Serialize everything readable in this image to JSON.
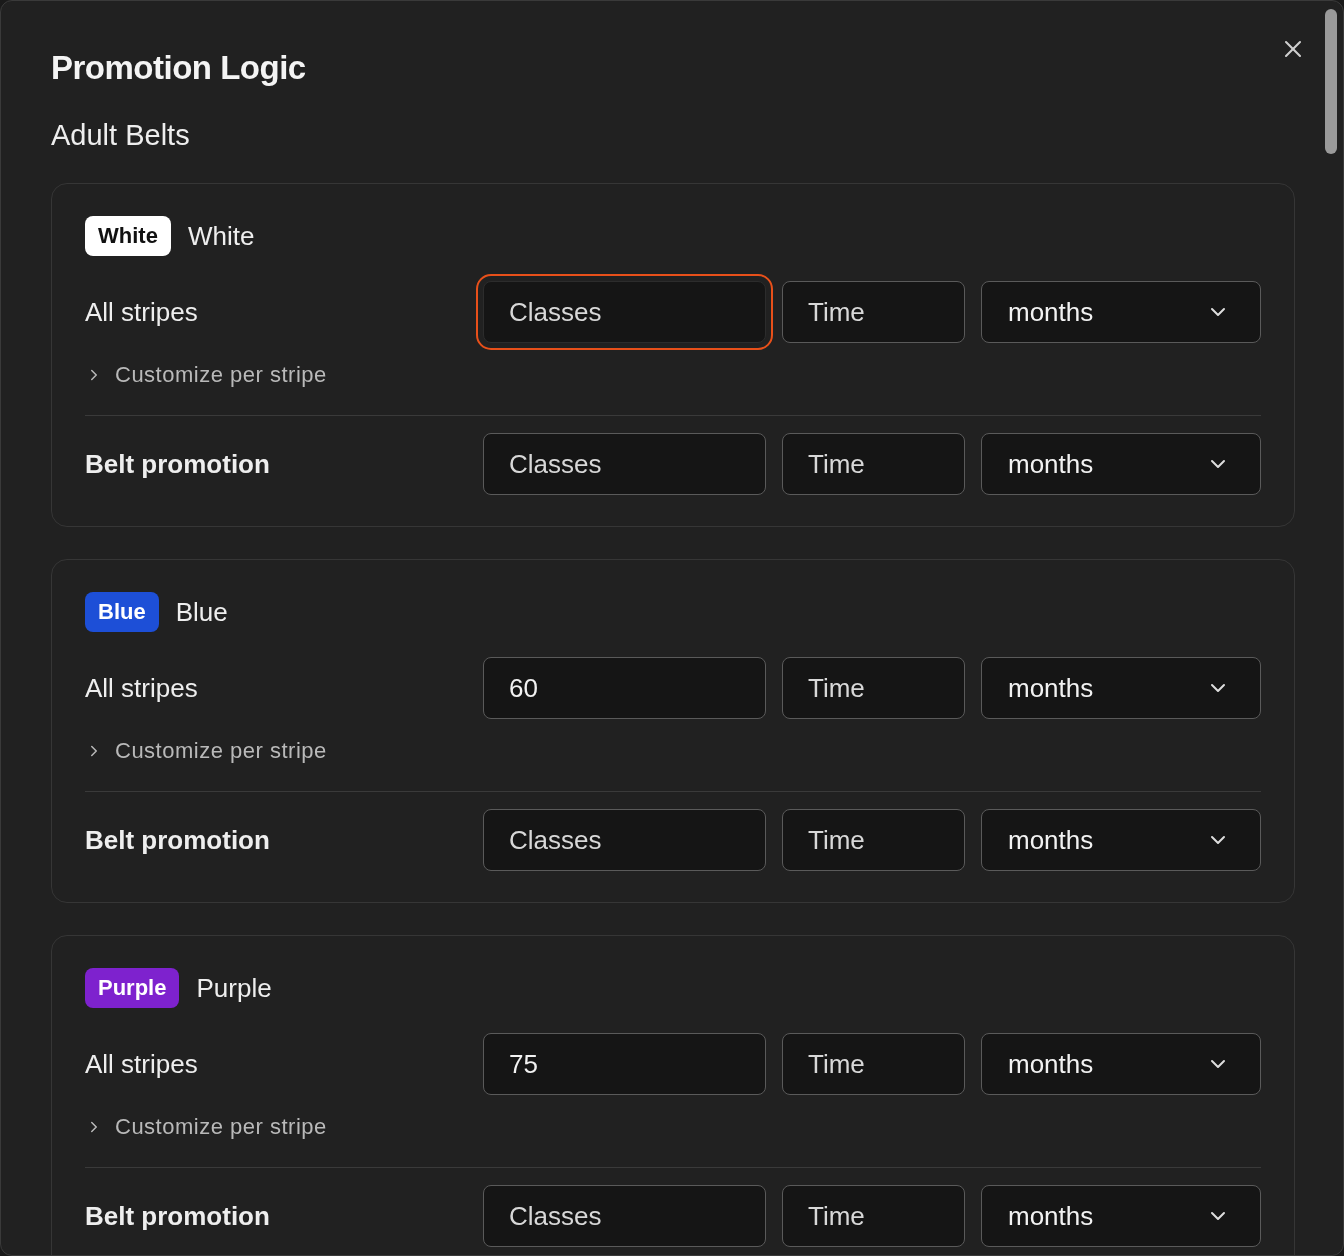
{
  "dialog": {
    "title": "Promotion Logic",
    "section_title": "Adult Belts"
  },
  "belts": [
    {
      "badge": "White",
      "color": "#ffffff",
      "name": "White",
      "rows": [
        {
          "kind": "stripes",
          "label": "All stripes",
          "count": {
            "placeholder": "Classes",
            "focused": true
          },
          "time": {
            "placeholder": "Time"
          },
          "unit": "months",
          "customize": "Customize per stripe"
        },
        {
          "kind": "promotion",
          "label": "Belt promotion",
          "count": {
            "placeholder": "Classes",
            "focused": false
          },
          "time": {
            "placeholder": "Time"
          },
          "unit": "months"
        }
      ]
    },
    {
      "badge": "Blue",
      "color": "#1d4fd7",
      "name": "Blue",
      "rows": [
        {
          "kind": "stripes",
          "label": "All stripes",
          "count": {
            "value": "60",
            "focused": false
          },
          "time": {
            "placeholder": "Time"
          },
          "unit": "months",
          "customize": "Customize per stripe"
        },
        {
          "kind": "promotion",
          "label": "Belt promotion",
          "count": {
            "placeholder": "Classes",
            "focused": false
          },
          "time": {
            "placeholder": "Time"
          },
          "unit": "months"
        }
      ]
    },
    {
      "badge": "Purple",
      "color": "#7e22ce",
      "name": "Purple",
      "rows": [
        {
          "kind": "stripes",
          "label": "All stripes",
          "count": {
            "value": "75",
            "focused": false
          },
          "time": {
            "placeholder": "Time"
          },
          "unit": "months",
          "customize": "Customize per stripe"
        },
        {
          "kind": "promotion",
          "label": "Belt promotion",
          "count": {
            "placeholder": "Classes",
            "focused": false
          },
          "time": {
            "placeholder": "Time"
          },
          "unit": "months"
        }
      ]
    }
  ]
}
